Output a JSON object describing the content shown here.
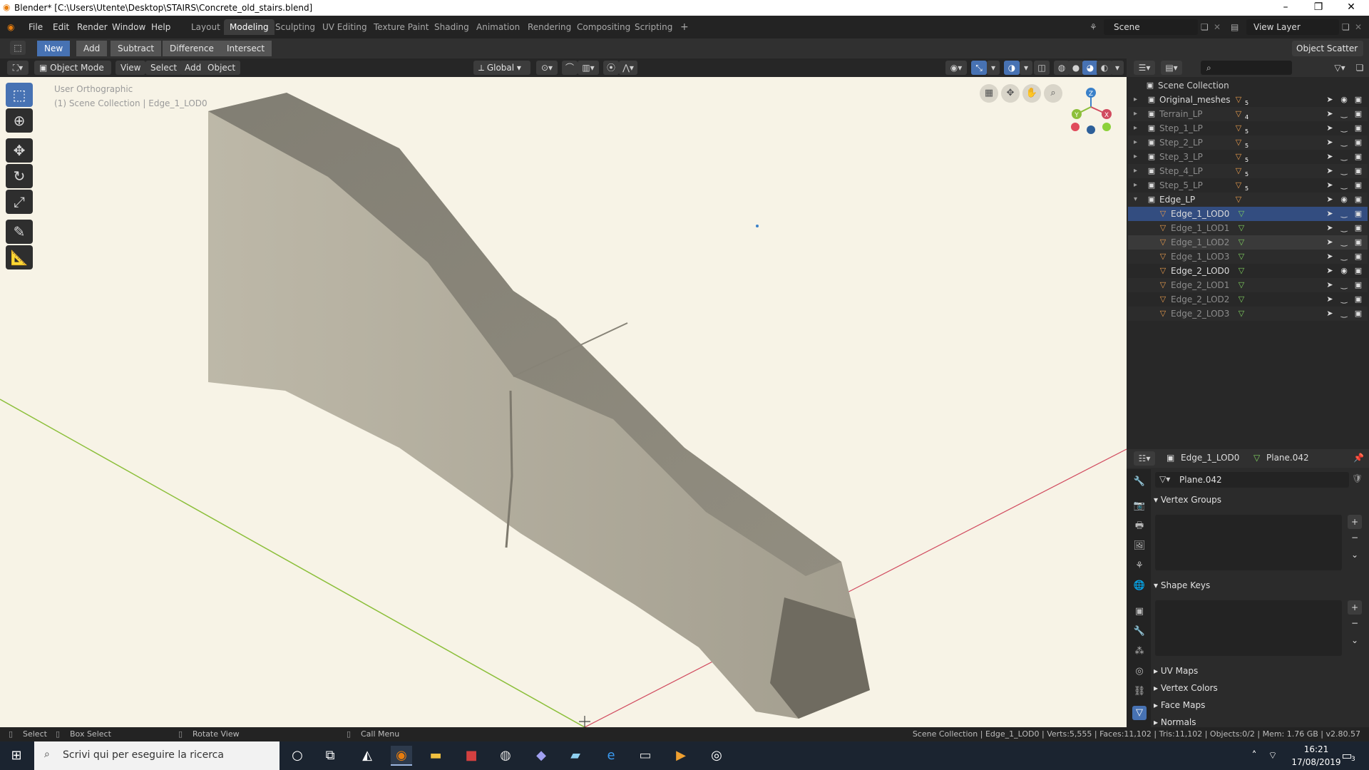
{
  "window": {
    "title": "Blender* [C:\\Users\\Utente\\Desktop\\STAIRS\\Concrete_old_stairs.blend]"
  },
  "menu": [
    "File",
    "Edit",
    "Render",
    "Window",
    "Help"
  ],
  "workspaces": [
    "Layout",
    "Modeling",
    "Sculpting",
    "UV Editing",
    "Texture Paint",
    "Shading",
    "Animation",
    "Rendering",
    "Compositing",
    "Scripting"
  ],
  "active_workspace": "Modeling",
  "scene": {
    "label": "Scene",
    "view_layer": "View Layer"
  },
  "toolrow": {
    "boolean_buttons": [
      "New",
      "Add",
      "Subtract",
      "Difference",
      "Intersect"
    ],
    "active": "New",
    "right_dropdown": "Object Scatter"
  },
  "viewport_header": {
    "mode": "Object Mode",
    "menus": [
      "View",
      "Select",
      "Add",
      "Object"
    ],
    "orientation": "Global"
  },
  "viewport": {
    "view_name": "User Orthographic",
    "collection_info": "(1) Scene Collection | Edge_1_LOD0",
    "gizmo_axes": {
      "x": "X",
      "y": "Y",
      "z": "Z"
    }
  },
  "outliner": {
    "root": "Scene Collection",
    "rows": [
      {
        "name": "Original_meshes",
        "type": "collection",
        "badge": "5"
      },
      {
        "name": "Terrain_LP",
        "type": "collection",
        "badge": "4"
      },
      {
        "name": "Step_1_LP",
        "type": "collection",
        "badge": "5"
      },
      {
        "name": "Step_2_LP",
        "type": "collection",
        "badge": "5"
      },
      {
        "name": "Step_3_LP",
        "type": "collection",
        "badge": "5"
      },
      {
        "name": "Step_4_LP",
        "type": "collection",
        "badge": "5"
      },
      {
        "name": "Step_5_LP",
        "type": "collection",
        "badge": "5"
      },
      {
        "name": "Edge_LP",
        "type": "collection",
        "badge": ""
      },
      {
        "name": "Edge_1_LOD0",
        "type": "mesh",
        "badge": ""
      },
      {
        "name": "Edge_1_LOD1",
        "type": "mesh",
        "badge": ""
      },
      {
        "name": "Edge_1_LOD2",
        "type": "mesh",
        "badge": ""
      },
      {
        "name": "Edge_1_LOD3",
        "type": "mesh",
        "badge": ""
      },
      {
        "name": "Edge_2_LOD0",
        "type": "mesh",
        "badge": ""
      },
      {
        "name": "Edge_2_LOD1",
        "type": "mesh",
        "badge": ""
      },
      {
        "name": "Edge_2_LOD2",
        "type": "mesh",
        "badge": ""
      },
      {
        "name": "Edge_2_LOD3",
        "type": "mesh",
        "badge": ""
      }
    ],
    "selected": "Edge_1_LOD0"
  },
  "properties": {
    "object_name": "Edge_1_LOD0",
    "mesh_name": "Plane.042",
    "datablock": "Plane.042",
    "panels": [
      "Vertex Groups",
      "Shape Keys",
      "UV Maps",
      "Vertex Colors",
      "Face Maps",
      "Normals"
    ]
  },
  "statusbar": {
    "left": [
      "Select",
      "Box Select",
      "Rotate View",
      "Call Menu"
    ],
    "right": "Scene Collection | Edge_1_LOD0 | Verts:5,555 | Faces:11,102 | Tris:11,102 | Objects:0/2 | Mem: 1.76 GB | v2.80.57"
  },
  "taskbar": {
    "search_placeholder": "Scrivi qui per eseguire la ricerca",
    "time": "16:21",
    "date": "17/08/2019",
    "notification_count": "3"
  },
  "colors": {
    "accent": "#4772b3",
    "viewport_bg": "#f7f3e6",
    "x_axis": "#d14b5f",
    "y_axis": "#8cbf3a",
    "z_axis": "#3a80c9"
  }
}
